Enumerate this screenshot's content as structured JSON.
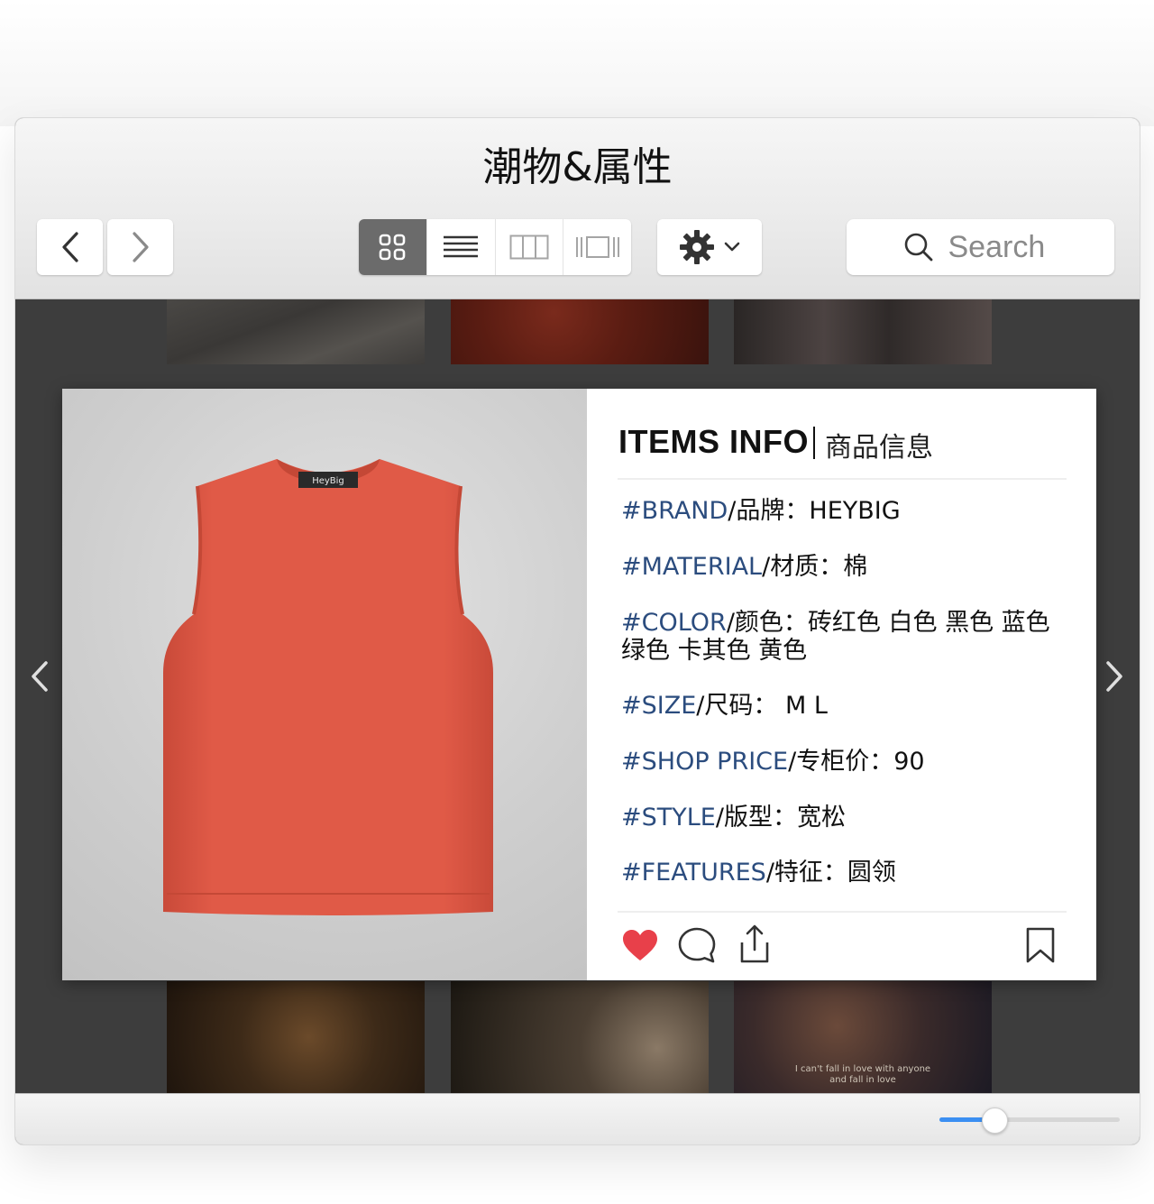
{
  "window": {
    "title": "潮物&属性"
  },
  "toolbar": {
    "search_placeholder": "Search",
    "view_modes": [
      "grid-view",
      "list-view",
      "column-view",
      "cover-flow-view"
    ],
    "active_view": "grid-view"
  },
  "card": {
    "info_title": "ITEMS INFO",
    "info_subtitle": "商品信息",
    "product_label": "HeyBig",
    "product_color": "#e05a47",
    "attributes": [
      {
        "key": "#BRAND",
        "label": "/品牌：",
        "value": "HEYBIG"
      },
      {
        "key": "#MATERIAL",
        "label": "/材质：",
        "value": "棉"
      },
      {
        "key": "#COLOR",
        "label": "/颜色：",
        "value": "砖红色  白色  黑色  蓝色",
        "value2": "绿色   卡其色   黄色"
      },
      {
        "key": "#SIZE",
        "label": "/尺码：",
        "value": " M L"
      },
      {
        "key": "#SHOP PRICE",
        "label": "/专柜价：",
        "value": "90"
      },
      {
        "key": "#STYLE",
        "label": "/版型：",
        "value": "宽松"
      },
      {
        "key": "#FEATURES",
        "label": "/特征：",
        "value": "圆领"
      }
    ]
  },
  "thumbnails": {
    "caption_line1": "I can't fall in love with anyone",
    "caption_line2": "and fall in love"
  },
  "colors": {
    "accent_blue": "#3b8ff2",
    "like_red": "#e8404a",
    "attr_key_blue": "#2b4c7e",
    "content_bg": "#3d3d3d"
  },
  "zoom": {
    "value": 0.3
  }
}
